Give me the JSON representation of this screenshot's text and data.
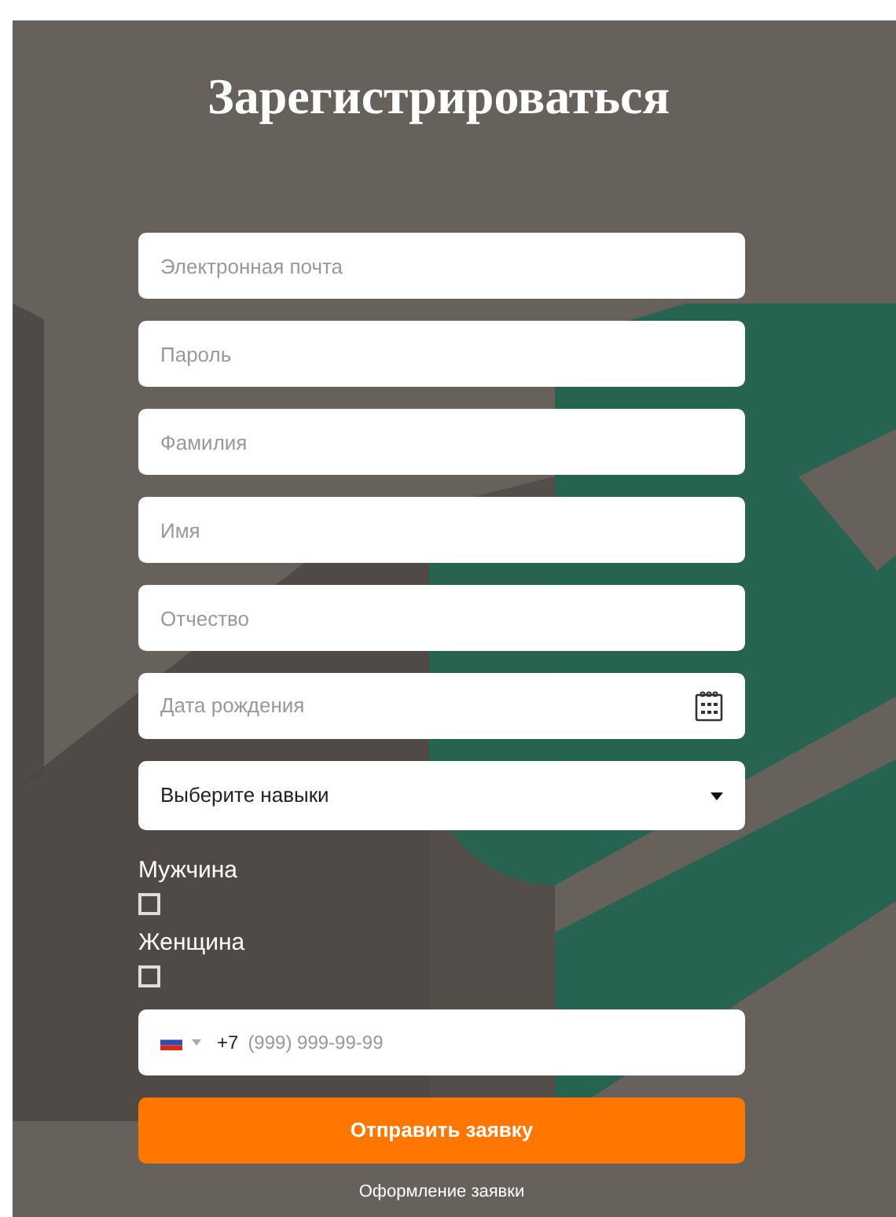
{
  "title": "Зарегистрироваться",
  "fields": [
    {
      "kind": "text",
      "placeholder": "Электронная почта"
    },
    {
      "kind": "text",
      "placeholder": "Пароль"
    },
    {
      "kind": "text",
      "placeholder": "Фамилия"
    },
    {
      "kind": "text",
      "placeholder": "Имя"
    },
    {
      "kind": "text",
      "placeholder": "Отчество"
    },
    {
      "kind": "date",
      "placeholder": "Дата рождения"
    },
    {
      "kind": "select",
      "value": "Выберите навыки"
    }
  ],
  "genders": [
    {
      "label": "Мужчина",
      "checked": false
    },
    {
      "label": "Женщина",
      "checked": false
    }
  ],
  "phone": {
    "prefix": "+7",
    "placeholder": "(999) 999-99-99"
  },
  "submit": "Отправить заявку",
  "footer": "Оформление заявки"
}
